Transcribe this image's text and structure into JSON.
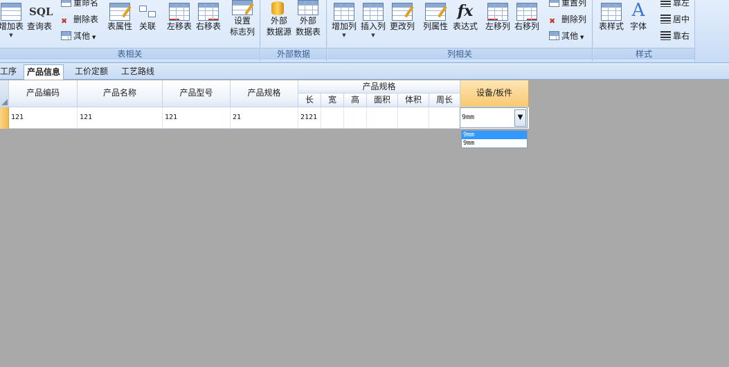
{
  "ribbon": {
    "groups": [
      {
        "label": "表相关",
        "buttons": [
          "增加表",
          "查询表",
          "表属性",
          "关联",
          "左移表",
          "右移表",
          "设置",
          "标志列"
        ],
        "small": [
          "重命名",
          "删除表",
          "其他"
        ],
        "sql_icon": "SQL"
      },
      {
        "label": "外部数据",
        "buttons": [
          "外部",
          "数据源",
          "外部",
          "数据表"
        ]
      },
      {
        "label": "列相关",
        "buttons": [
          "增加列",
          "插入列",
          "更改列",
          "列属性",
          "表达式",
          "左移列",
          "右移列"
        ],
        "small": [
          "重置列",
          "删除列",
          "其他"
        ],
        "fx_icon": "fx"
      },
      {
        "label": "样式",
        "buttons": [
          "表样式",
          "字体"
        ],
        "small": [
          "靠左",
          "居中",
          "靠右"
        ],
        "font_icon": "A"
      }
    ]
  },
  "tabs": [
    "工序",
    "产品信息",
    "工价定额",
    "工艺路线"
  ],
  "grid": {
    "headers": [
      "产品编码",
      "产品名称",
      "产品型号",
      "产品规格"
    ],
    "group_header": "产品规格",
    "sub_headers": [
      "长",
      "宽",
      "高",
      "面积",
      "体积",
      "周长"
    ],
    "last_header": "设备/板件",
    "row": [
      "121",
      "121",
      "121",
      "21",
      "2121",
      "",
      "",
      "",
      "",
      ""
    ]
  },
  "combo": {
    "value": "9mm",
    "options": [
      "9mm",
      "9mm"
    ]
  },
  "colors": {
    "accent": "#3399ff",
    "header_highlight": "#f8c872",
    "background": "#a9a9a9"
  }
}
